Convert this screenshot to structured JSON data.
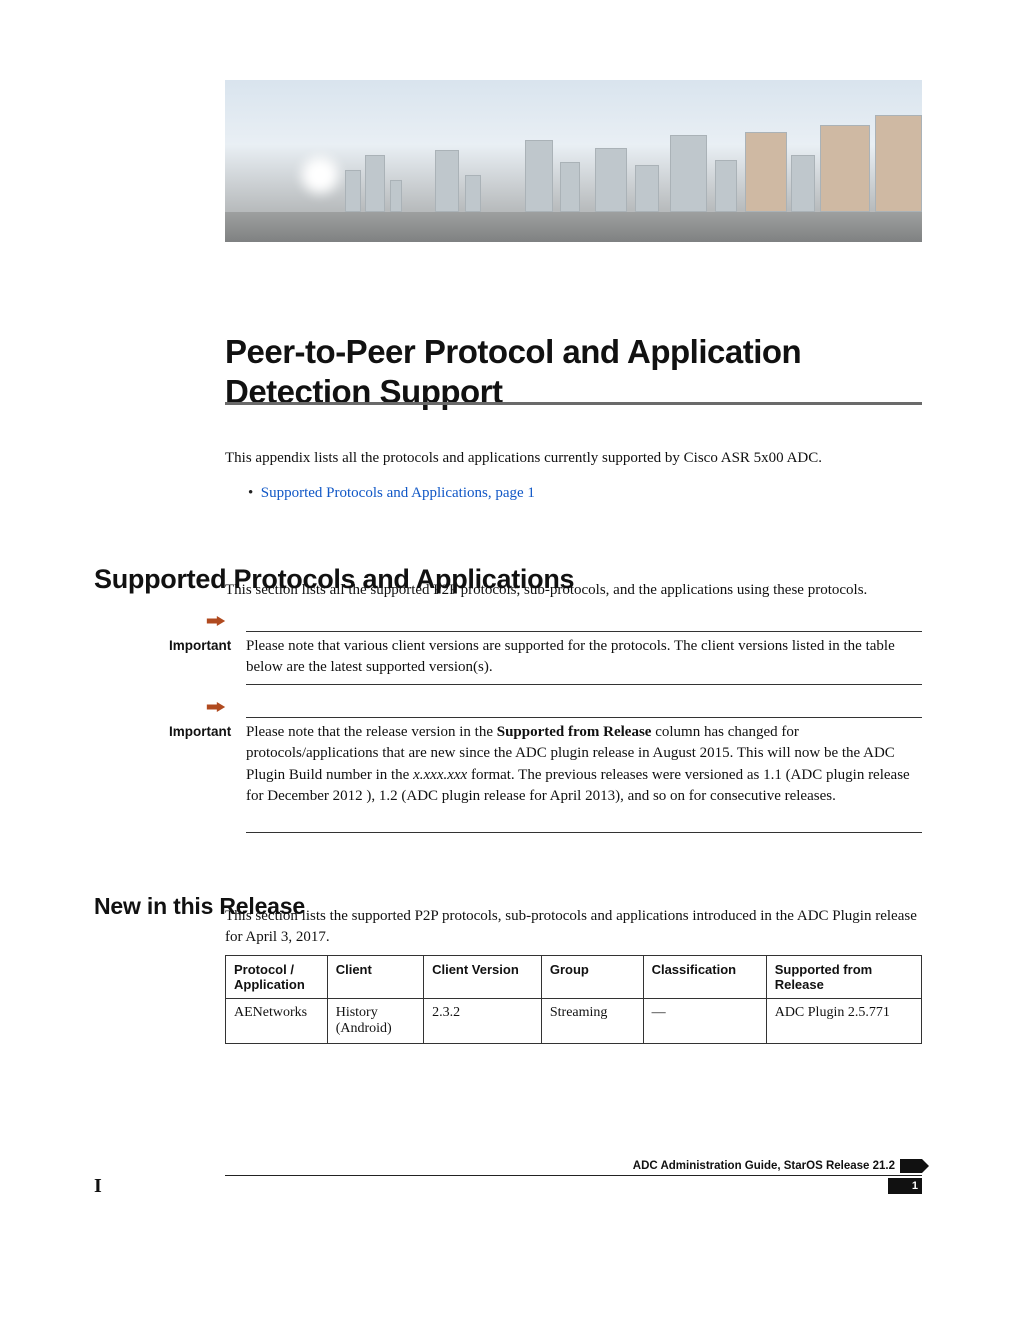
{
  "title": "Peer-to-Peer Protocol and Application Detection Support",
  "intro": "This appendix lists all the protocols and applications currently supported by Cisco ASR 5x00 ADC.",
  "toc_bullet": "•",
  "toc_link": "Supported Protocols and Applications,  page  1",
  "section_heading": "Supported Protocols and Applications",
  "section_intro": "This section lists all the supported P2P protocols, sub-protocols, and the applications using these protocols.",
  "important_label": "Important",
  "note1": "Please note that various client versions are supported for the protocols. The client versions listed in the table below are the latest supported version(s).",
  "note2_pre": "Please note that the release version in the ",
  "note2_bold": "Supported from Release",
  "note2_mid": " column has changed for protocols/applications that are new since the ADC plugin release in August 2015. This will now be the ADC Plugin Build number in the ",
  "note2_italic": "x.xxx.xxx",
  "note2_post": " format. The previous releases were versioned as 1.1 (ADC plugin release for December 2012 ), 1.2 (ADC plugin release for April 2013), and so on for consecutive releases.",
  "subheading": "New in this Release",
  "sub_intro": "This section lists the supported P2P protocols, sub-protocols and applications introduced in the ADC Plugin release for April 3, 2017.",
  "table": {
    "headers": {
      "c1": "Protocol / Application",
      "c2": "Client",
      "c3": "Client Version",
      "c4": "Group",
      "c5": "Classification",
      "c6": "Supported from Release"
    },
    "row": {
      "c1": "AENetworks",
      "c2": "History (Android)",
      "c3": "2.3.2",
      "c4": "Streaming",
      "c5": "—",
      "c6": "ADC Plugin 2.5.771"
    }
  },
  "footer": {
    "guide": "ADC Administration Guide, StarOS Release 21.2",
    "page": "1",
    "mark": "I"
  }
}
